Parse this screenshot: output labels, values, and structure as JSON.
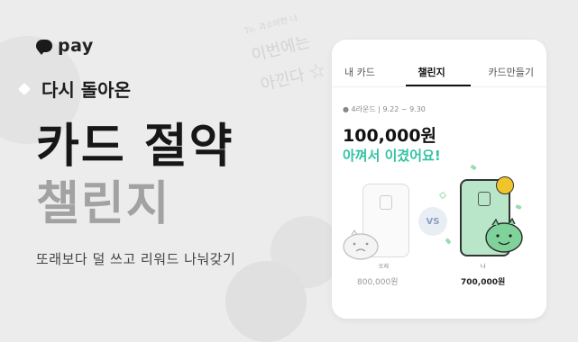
{
  "brand": {
    "name": "pay"
  },
  "hero": {
    "tagline": "다시 돌아온",
    "headline_1": "카드 절약",
    "headline_2": "챌린지",
    "subtitle": "또래보다 덜 쓰고 리워드 나눠갖기"
  },
  "decorations": {
    "stamp_top": "To. 과소비한 나",
    "stamp_mid": "이번에는",
    "stamp_bot": "아낀다 ☆"
  },
  "phone": {
    "tabs": [
      {
        "label": "내 카드"
      },
      {
        "label": "챌린지"
      },
      {
        "label": "카드만들기"
      }
    ],
    "round_info": "● 4라운드 | 9.22 ~ 9.30",
    "amount": "100,000원",
    "result": "아껴서 이겼어요!",
    "vs_label": "VS",
    "left_label": "또래",
    "left_value": "800,000원",
    "right_label": "나",
    "right_value": "700,000원"
  },
  "colors": {
    "accent": "#31c3a2",
    "card_green": "#b9e6c9",
    "medal": "#f0c52a"
  }
}
